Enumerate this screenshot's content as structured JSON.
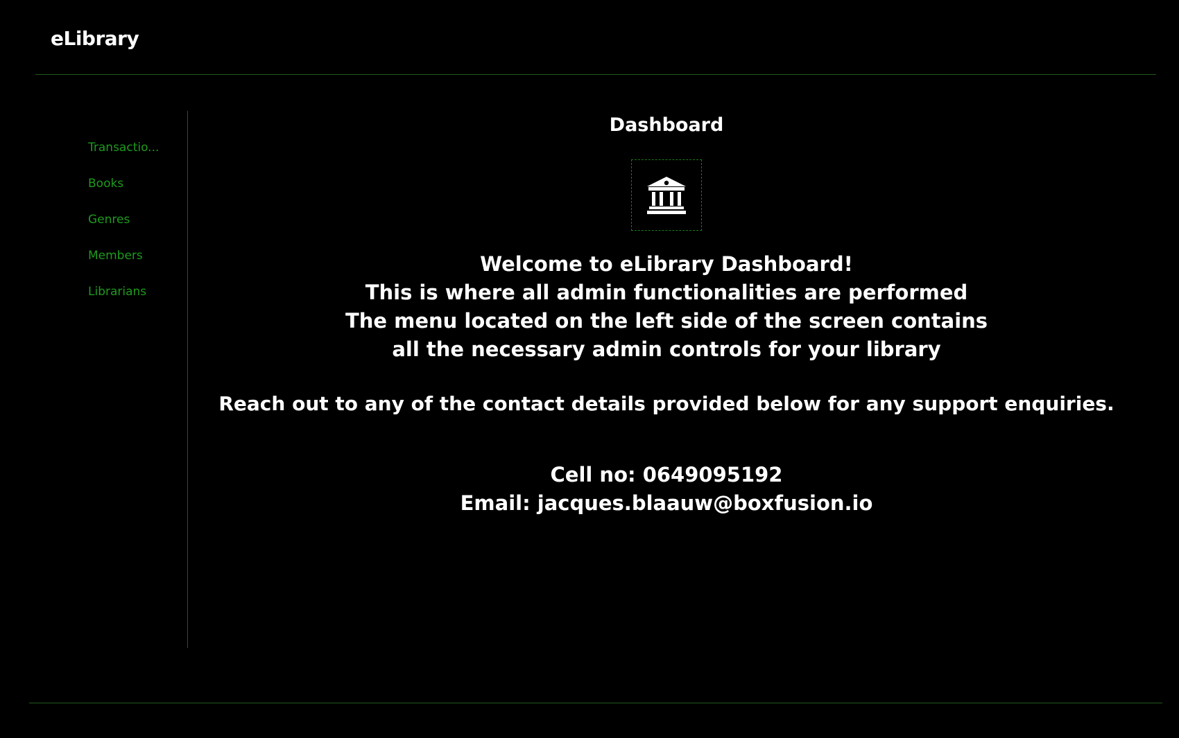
{
  "header": {
    "brand": "eLibrary"
  },
  "sidebar": {
    "items": [
      {
        "label": "Transactio..."
      },
      {
        "label": "Books"
      },
      {
        "label": "Genres"
      },
      {
        "label": "Members"
      },
      {
        "label": "Librarians"
      }
    ]
  },
  "main": {
    "title": "Dashboard",
    "icon": "bank-icon",
    "welcome_lines": [
      "Welcome to eLibrary Dashboard!",
      "This is where all admin functionalities are performed",
      "The menu located on the left side of the screen contains",
      "all the necessary admin controls for your library"
    ],
    "support_text": "Reach out to any of the contact details provided below for any support enquiries.",
    "contact": {
      "cell": "Cell no: 0649095192",
      "email": "Email: jacques.blaauw@boxfusion.io"
    }
  },
  "colors": {
    "background": "#000000",
    "text": "#ffffff",
    "accent": "#1e9a1e",
    "divider": "#1f5a1f"
  }
}
